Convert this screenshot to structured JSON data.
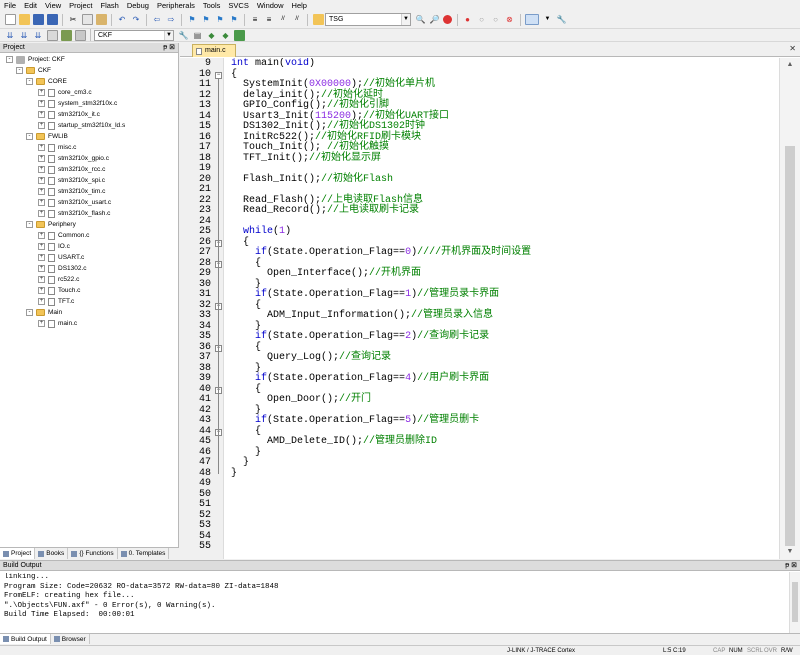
{
  "menu": [
    "File",
    "Edit",
    "View",
    "Project",
    "Flash",
    "Debug",
    "Peripherals",
    "Tools",
    "SVCS",
    "Window",
    "Help"
  ],
  "toolbar": {
    "find_value": "TSG",
    "target_value": "CKF"
  },
  "project_pane": {
    "title": "Project",
    "root": "Project: CKF",
    "target": "CKF",
    "groups": [
      {
        "name": "CORE",
        "files": [
          "core_cm3.c",
          "system_stm32f10x.c",
          "stm32f10x_it.c",
          "startup_stm32f10x_ld.s"
        ]
      },
      {
        "name": "FWLIB",
        "files": [
          "misc.c",
          "stm32f10x_gpio.c",
          "stm32f10x_rcc.c",
          "stm32f10x_spi.c",
          "stm32f10x_tim.c",
          "stm32f10x_usart.c",
          "stm32f10x_flash.c"
        ]
      },
      {
        "name": "Periphery",
        "files": [
          "Common.c",
          "IO.c",
          "USART.c",
          "DS1302.c",
          "rc522.c",
          "Touch.c",
          "TFT.c"
        ]
      },
      {
        "name": "Main",
        "files": [
          "main.c"
        ]
      }
    ],
    "tabs": [
      "Project",
      "Books",
      "{} Functions",
      "0. Templates"
    ]
  },
  "editor": {
    "tab": "main.c",
    "lines": [
      {
        "n": 9,
        "fold": "",
        "code": [
          [
            "kw",
            "int"
          ],
          [
            "",
            " main("
          ],
          [
            "kw",
            "void"
          ],
          [
            "",
            ")"
          ]
        ]
      },
      {
        "n": 10,
        "fold": "-",
        "code": [
          [
            "",
            "{"
          ]
        ]
      },
      {
        "n": 11,
        "fold": "",
        "code": [
          [
            "",
            "  SystemInit("
          ],
          [
            "num",
            "0X00000"
          ],
          [
            "",
            ");"
          ],
          [
            "cm",
            "//初始化单片机"
          ]
        ]
      },
      {
        "n": 12,
        "fold": "",
        "code": [
          [
            "",
            "  delay_init();"
          ],
          [
            "cm",
            "//初始化延时"
          ]
        ]
      },
      {
        "n": 13,
        "fold": "",
        "code": [
          [
            "",
            "  GPIO_Config();"
          ],
          [
            "cm",
            "//初始化引脚"
          ]
        ]
      },
      {
        "n": 14,
        "fold": "",
        "code": [
          [
            "",
            "  Usart3_Init("
          ],
          [
            "num",
            "115200"
          ],
          [
            "",
            ");"
          ],
          [
            "cm",
            "//初始化UART接口"
          ]
        ]
      },
      {
        "n": 15,
        "fold": "",
        "code": [
          [
            "",
            "  DS1302_Init();"
          ],
          [
            "cm",
            "//初始化DS1302时钟"
          ]
        ]
      },
      {
        "n": 16,
        "fold": "",
        "code": [
          [
            "",
            "  InitRc522();"
          ],
          [
            "cm",
            "//初始化RFID刷卡模块"
          ]
        ]
      },
      {
        "n": 17,
        "fold": "",
        "code": [
          [
            "",
            "  Touch_Init(); "
          ],
          [
            "cm",
            "//初始化触摸"
          ]
        ]
      },
      {
        "n": 18,
        "fold": "",
        "code": [
          [
            "",
            "  TFT_Init();"
          ],
          [
            "cm",
            "//初始化显示屏"
          ]
        ]
      },
      {
        "n": 19,
        "fold": "",
        "code": [
          [
            "",
            ""
          ]
        ]
      },
      {
        "n": 20,
        "fold": "",
        "code": [
          [
            "",
            "  Flash_Init();"
          ],
          [
            "cm",
            "//初始化Flash"
          ]
        ]
      },
      {
        "n": 21,
        "fold": "",
        "code": [
          [
            "",
            ""
          ]
        ]
      },
      {
        "n": 22,
        "fold": "",
        "code": [
          [
            "",
            "  Read_Flash();"
          ],
          [
            "cm",
            "//上电读取Flash信息"
          ]
        ]
      },
      {
        "n": 23,
        "fold": "",
        "code": [
          [
            "",
            "  Read_Record();"
          ],
          [
            "cm",
            "//上电读取刷卡记录"
          ]
        ]
      },
      {
        "n": 24,
        "fold": "",
        "code": [
          [
            "",
            ""
          ]
        ]
      },
      {
        "n": 25,
        "fold": "",
        "code": [
          [
            "",
            "  "
          ],
          [
            "kw",
            "while"
          ],
          [
            "",
            "("
          ],
          [
            "num",
            "1"
          ],
          [
            "",
            ")"
          ]
        ]
      },
      {
        "n": 26,
        "fold": "-",
        "code": [
          [
            "",
            "  {"
          ]
        ]
      },
      {
        "n": 27,
        "fold": "",
        "code": [
          [
            "",
            "    "
          ],
          [
            "kw",
            "if"
          ],
          [
            "",
            "(State.Operation_Flag=="
          ],
          [
            "num",
            "0"
          ],
          [
            "",
            ")"
          ],
          [
            "cm",
            "////开机界面及时间设置"
          ]
        ]
      },
      {
        "n": 28,
        "fold": "-",
        "code": [
          [
            "",
            "    {"
          ]
        ]
      },
      {
        "n": 29,
        "fold": "",
        "code": [
          [
            "",
            "      Open_Interface();"
          ],
          [
            "cm",
            "//开机界面"
          ]
        ]
      },
      {
        "n": 30,
        "fold": "",
        "code": [
          [
            "",
            "    }"
          ]
        ]
      },
      {
        "n": 31,
        "fold": "",
        "code": [
          [
            "",
            "    "
          ],
          [
            "kw",
            "if"
          ],
          [
            "",
            "(State.Operation_Flag=="
          ],
          [
            "num",
            "1"
          ],
          [
            "",
            ")"
          ],
          [
            "cm",
            "//管理员录卡界面"
          ]
        ]
      },
      {
        "n": 32,
        "fold": "-",
        "code": [
          [
            "",
            "    {"
          ]
        ]
      },
      {
        "n": 33,
        "fold": "",
        "code": [
          [
            "",
            "      ADM_Input_Information();"
          ],
          [
            "cm",
            "//管理员录入信息"
          ]
        ]
      },
      {
        "n": 34,
        "fold": "",
        "code": [
          [
            "",
            "    }"
          ]
        ]
      },
      {
        "n": 35,
        "fold": "",
        "code": [
          [
            "",
            "    "
          ],
          [
            "kw",
            "if"
          ],
          [
            "",
            "(State.Operation_Flag=="
          ],
          [
            "num",
            "2"
          ],
          [
            "",
            ")"
          ],
          [
            "cm",
            "//查询刷卡记录"
          ]
        ]
      },
      {
        "n": 36,
        "fold": "-",
        "code": [
          [
            "",
            "    {"
          ]
        ]
      },
      {
        "n": 37,
        "fold": "",
        "code": [
          [
            "",
            "      Query_Log();"
          ],
          [
            "cm",
            "//查询记录"
          ]
        ]
      },
      {
        "n": 38,
        "fold": "",
        "code": [
          [
            "",
            "    }"
          ]
        ]
      },
      {
        "n": 39,
        "fold": "",
        "code": [
          [
            "",
            "    "
          ],
          [
            "kw",
            "if"
          ],
          [
            "",
            "(State.Operation_Flag=="
          ],
          [
            "num",
            "4"
          ],
          [
            "",
            ")"
          ],
          [
            "cm",
            "//用户刷卡界面"
          ]
        ]
      },
      {
        "n": 40,
        "fold": "-",
        "code": [
          [
            "",
            "    {"
          ]
        ]
      },
      {
        "n": 41,
        "fold": "",
        "code": [
          [
            "",
            "      Open_Door();"
          ],
          [
            "cm",
            "//开门"
          ]
        ]
      },
      {
        "n": 42,
        "fold": "",
        "code": [
          [
            "",
            "    }"
          ]
        ]
      },
      {
        "n": 43,
        "fold": "",
        "code": [
          [
            "",
            "    "
          ],
          [
            "kw",
            "if"
          ],
          [
            "",
            "(State.Operation_Flag=="
          ],
          [
            "num",
            "5"
          ],
          [
            "",
            ")"
          ],
          [
            "cm",
            "//管理员删卡"
          ]
        ]
      },
      {
        "n": 44,
        "fold": "-",
        "code": [
          [
            "",
            "    {"
          ]
        ]
      },
      {
        "n": 45,
        "fold": "",
        "code": [
          [
            "",
            "      AMD_Delete_ID();"
          ],
          [
            "cm",
            "//管理员删除ID"
          ]
        ]
      },
      {
        "n": 46,
        "fold": "",
        "code": [
          [
            "",
            "    }"
          ]
        ]
      },
      {
        "n": 47,
        "fold": "",
        "code": [
          [
            "",
            "  }"
          ]
        ]
      },
      {
        "n": 48,
        "fold": "",
        "code": [
          [
            "",
            "}"
          ]
        ]
      },
      {
        "n": 49,
        "fold": "",
        "code": [
          [
            "",
            ""
          ]
        ]
      },
      {
        "n": 50,
        "fold": "",
        "code": [
          [
            "",
            ""
          ]
        ]
      },
      {
        "n": 51,
        "fold": "",
        "code": [
          [
            "",
            ""
          ]
        ]
      },
      {
        "n": 52,
        "fold": "",
        "code": [
          [
            "",
            ""
          ]
        ]
      },
      {
        "n": 53,
        "fold": "",
        "code": [
          [
            "",
            ""
          ]
        ]
      },
      {
        "n": 54,
        "fold": "",
        "code": [
          [
            "",
            ""
          ]
        ]
      },
      {
        "n": 55,
        "fold": "",
        "code": [
          [
            "",
            ""
          ]
        ]
      }
    ]
  },
  "build_output": {
    "title": "Build Output",
    "lines": [
      "linking...",
      "Program Size: Code=20632 RO-data=3572 RW-data=80 ZI-data=1848",
      "FromELF: creating hex file...",
      "\".\\Objects\\FUN.axf\" - 0 Error(s), 0 Warning(s).",
      "Build Time Elapsed:  00:00:01"
    ],
    "tabs": [
      "Build Output",
      "Browser"
    ]
  },
  "status": {
    "debugger": "J-LINK / J-TRACE Cortex",
    "position": "L:5 C:19",
    "caps": "CAP",
    "num": "NUM",
    "scrl": "SCRL",
    "ovr": "OVR",
    "rw": "R/W"
  }
}
